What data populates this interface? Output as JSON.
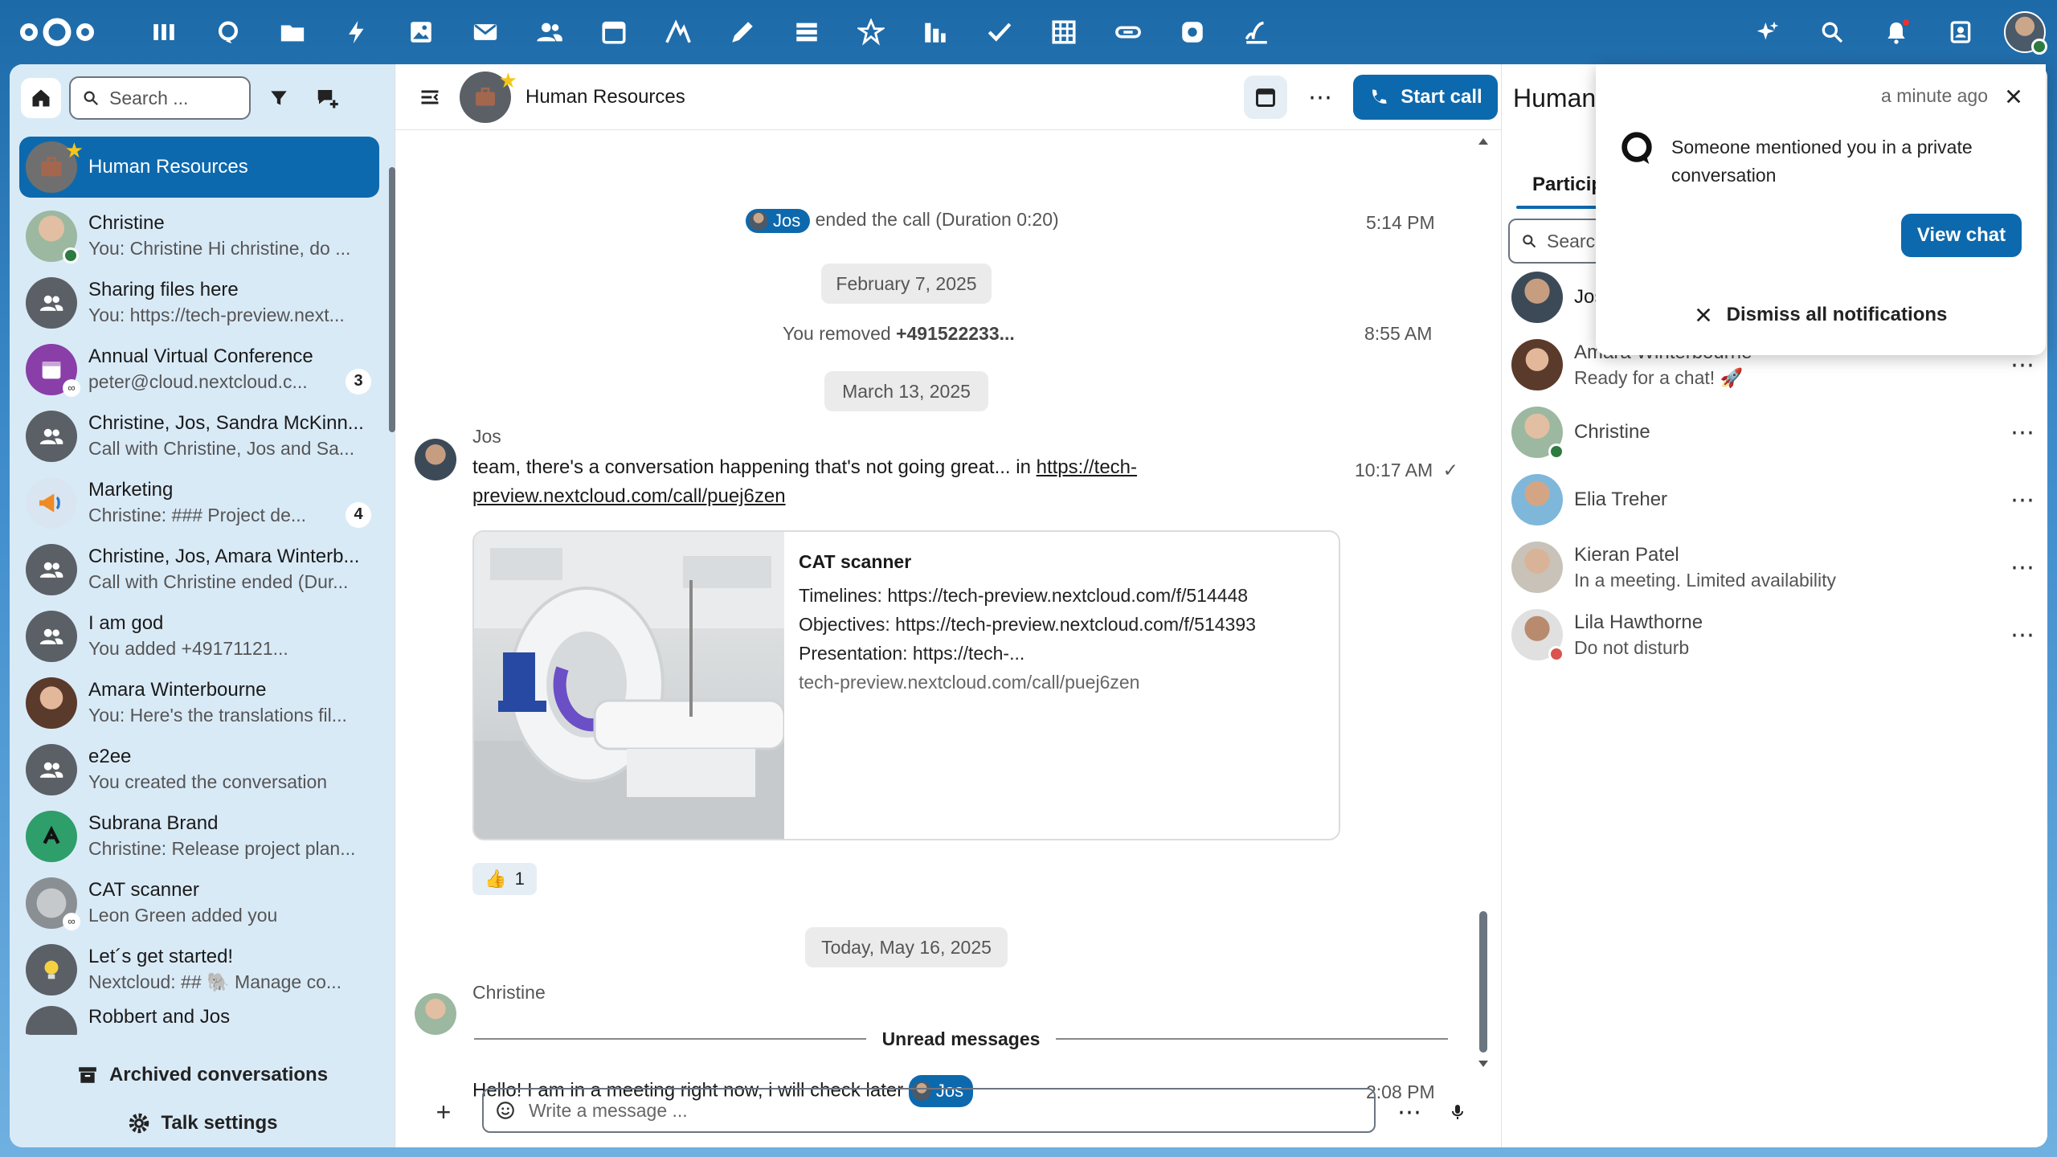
{
  "header": {
    "apps": [
      "dashboard-icon",
      "talk-icon",
      "files-icon",
      "activity-icon",
      "photos-icon",
      "mail-icon",
      "contacts-icon",
      "calendar-icon",
      "analytics-icon",
      "notes-icon",
      "deck-icon",
      "assistant-icon",
      "stats-icon",
      "tasks-icon",
      "tables-icon",
      "link-icon",
      "settings-app-icon",
      "sign-icon"
    ],
    "right": [
      "assistant-sparkle-icon",
      "search-icon",
      "notifications-icon",
      "contacts-menu-icon",
      "user-avatar"
    ]
  },
  "sidebar": {
    "search_placeholder": "Search ...",
    "conversations": [
      {
        "name": "Human Resources",
        "sub": "",
        "active": true,
        "favorite": true
      },
      {
        "name": "Christine",
        "sub": "You: Christine Hi christine, do ...",
        "online": true
      },
      {
        "name": "Sharing files here",
        "sub": "You: https://tech-preview.next..."
      },
      {
        "name": "Annual Virtual Conference",
        "sub": "peter@cloud.nextcloud.c...",
        "badge": "3",
        "link": true
      },
      {
        "name": "Christine, Jos, Sandra McKinn...",
        "sub": "Call with Christine, Jos and Sa..."
      },
      {
        "name": "Marketing",
        "sub": "Christine: ### Project de...",
        "badge": "4"
      },
      {
        "name": "Christine, Jos, Amara Winterb...",
        "sub": "Call with Christine ended (Dur..."
      },
      {
        "name": "I am god",
        "sub": "You added +49171121..."
      },
      {
        "name": "Amara Winterbourne",
        "sub": "You: Here's the translations fil..."
      },
      {
        "name": "e2ee",
        "sub": "You created the conversation"
      },
      {
        "name": "Subrana Brand",
        "sub": "Christine: Release project plan..."
      },
      {
        "name": "CAT scanner",
        "sub": "Leon Green added you",
        "link": true
      },
      {
        "name": "Let´s get started!",
        "sub": "Nextcloud: ## 🐘 Manage co..."
      },
      {
        "name": "Robbert and Jos",
        "sub": ""
      }
    ],
    "archived_label": "Archived conversations",
    "settings_label": "Talk settings"
  },
  "chat": {
    "title": "Human Resources",
    "start_call": "Start call",
    "messages": {
      "call_ended_mention": "Jos",
      "call_ended_text": "ended the call (Duration 0:20)",
      "call_ended_time": "5:14 PM",
      "date1": "February 7, 2025",
      "removed_prefix": "You removed",
      "removed_number": "+491522233...",
      "removed_time": "8:55 AM",
      "date2": "March 13, 2025",
      "jos_author": "Jos",
      "jos_text": "team, there's a conversation happening that's not going great... in",
      "jos_link": "https://tech-preview.nextcloud.com/call/puej6zen",
      "jos_link_line1": "https://tech-",
      "jos_link_line2": "preview.nextcloud.com/call/puej6zen",
      "jos_time": "10:17 AM",
      "preview_title": "CAT scanner",
      "preview_line1": "Timelines: https://tech-preview.nextcloud.com/f/514448",
      "preview_line2": "Objectives: https://tech-preview.nextcloud.com/f/514393",
      "preview_line3": "Presentation: https://tech-...",
      "preview_url": "tech-preview.nextcloud.com/call/puej6zen",
      "reaction_emoji": "👍",
      "reaction_count": "1",
      "date3": "Today, May 16, 2025",
      "christine_author": "Christine",
      "unread_label": "Unread messages",
      "christine_text": "Hello! I am in a meeting right now, i will check later",
      "christine_mention": "Jos",
      "christine_time": "2:08 PM"
    },
    "composer_placeholder": "Write a message ..."
  },
  "right_sidebar": {
    "title": "Human",
    "tab": "Particip",
    "search_placeholder": "Search",
    "participants": [
      {
        "name": "Jos",
        "status": ""
      },
      {
        "name": "Amara Winterbourne",
        "status": "Ready for a chat! 🚀"
      },
      {
        "name": "Christine",
        "status": ""
      },
      {
        "name": "Elia Treher",
        "status": ""
      },
      {
        "name": "Kieran Patel",
        "status": "In a meeting. Limited availability"
      },
      {
        "name": "Lila Hawthorne",
        "status": "Do not disturb"
      }
    ]
  },
  "notification": {
    "time": "a minute ago",
    "message": "Someone mentioned you in a private conversation",
    "view_label": "View chat",
    "dismiss_label": "Dismiss all notifications"
  }
}
